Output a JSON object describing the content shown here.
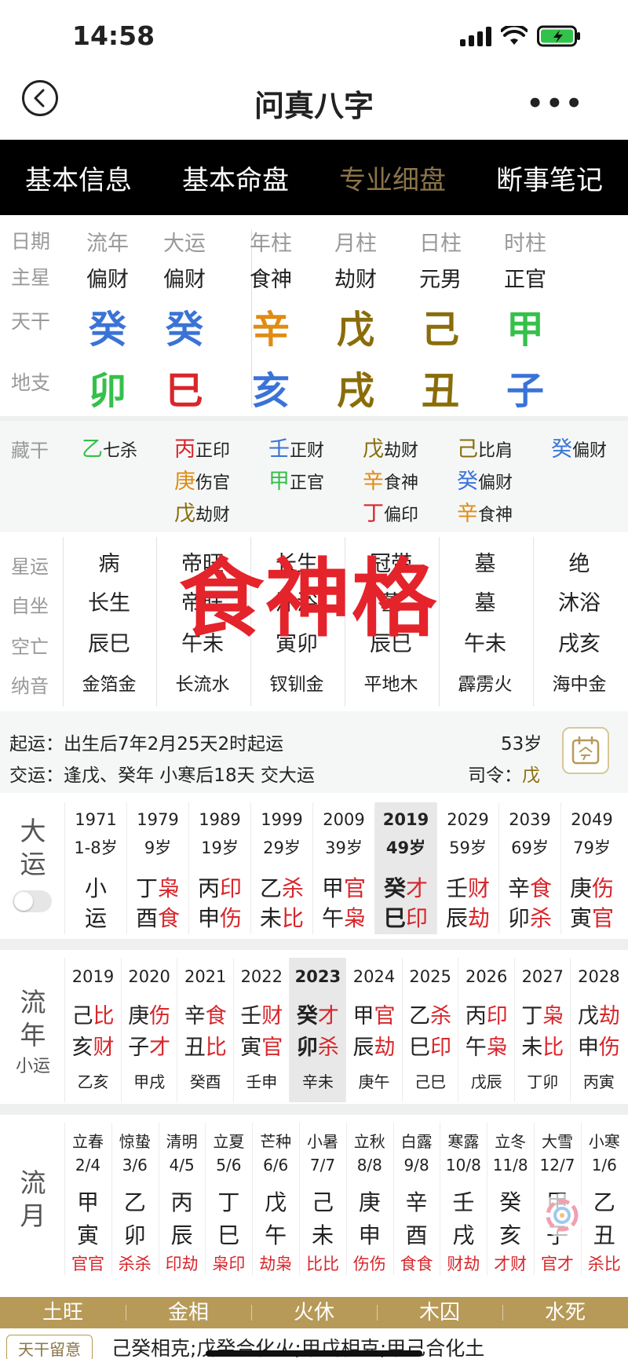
{
  "status": {
    "time": "14:58"
  },
  "nav": {
    "title": "问真八字",
    "more": "•••"
  },
  "tabs": [
    "基本信息",
    "基本命盘",
    "专业细盘",
    "断事笔记"
  ],
  "pillars": {
    "row_labels": {
      "rizhu": "日期",
      "star": "主星",
      "gan": "天干",
      "zhi": "地支"
    },
    "columns": [
      {
        "head": "流年",
        "star": "偏财",
        "gan": "癸",
        "gan_color": "#3a73d6",
        "zhi": "卯",
        "zhi_color": "#35c04a"
      },
      {
        "head": "大运",
        "star": "偏财",
        "gan": "癸",
        "gan_color": "#3a73d6",
        "zhi": "巳",
        "zhi_color": "#d8262b"
      },
      {
        "head": "年柱",
        "star": "食神",
        "gan": "辛",
        "gan_color": "#e08b13",
        "zhi": "亥",
        "zhi_color": "#3a73d6"
      },
      {
        "head": "月柱",
        "star": "劫财",
        "gan": "戊",
        "gan_color": "#8a6d0a",
        "zhi": "戌",
        "zhi_color": "#8a6d0a"
      },
      {
        "head": "日柱",
        "star": "元男",
        "gan": "己",
        "gan_color": "#8a6d0a",
        "zhi": "丑",
        "zhi_color": "#8a6d0a"
      },
      {
        "head": "时柱",
        "star": "正官",
        "gan": "甲",
        "gan_color": "#35c04a",
        "zhi": "子",
        "zhi_color": "#3a73d6"
      }
    ]
  },
  "canggan": {
    "label": "藏干",
    "columns": [
      [
        {
          "g": "乙",
          "c": "#35c04a",
          "s": "七杀"
        }
      ],
      [
        {
          "g": "丙",
          "c": "#d8262b",
          "s": "正印"
        },
        {
          "g": "庚",
          "c": "#e08b13",
          "s": "伤官"
        },
        {
          "g": "戊",
          "c": "#8a6d0a",
          "s": "劫财"
        }
      ],
      [
        {
          "g": "壬",
          "c": "#3a73d6",
          "s": "正财"
        },
        {
          "g": "甲",
          "c": "#35c04a",
          "s": "正官"
        }
      ],
      [
        {
          "g": "戊",
          "c": "#8a6d0a",
          "s": "劫财"
        },
        {
          "g": "辛",
          "c": "#e08b13",
          "s": "食神"
        },
        {
          "g": "丁",
          "c": "#d8262b",
          "s": "偏印"
        }
      ],
      [
        {
          "g": "己",
          "c": "#8a6d0a",
          "s": "比肩"
        },
        {
          "g": "癸",
          "c": "#3a73d6",
          "s": "偏财"
        },
        {
          "g": "辛",
          "c": "#e08b13",
          "s": "食神"
        }
      ],
      [
        {
          "g": "癸",
          "c": "#3a73d6",
          "s": "偏财"
        }
      ]
    ]
  },
  "grid2": {
    "labels": [
      "星运",
      "自坐",
      "空亡",
      "纳音"
    ],
    "columns": [
      [
        "病",
        "长生",
        "辰巳",
        "金箔金"
      ],
      [
        "帝旺",
        "帝旺",
        "午未",
        "长流水"
      ],
      [
        "长生",
        "沐浴",
        "寅卯",
        "钗钏金"
      ],
      [
        "冠带",
        "墓",
        "辰巳",
        "平地木"
      ],
      [
        "墓",
        "墓",
        "午未",
        "霹雳火"
      ],
      [
        "绝",
        "沐浴",
        "戌亥",
        "海中金"
      ]
    ],
    "overlay": "食神格"
  },
  "qiyun": {
    "line1": "起运：出生后7年2月25天2时起运",
    "line2": "交运：逢戊、癸年 小寒后18天 交大运",
    "age": "53岁",
    "siling_label": "司令：",
    "siling_value": "戊"
  },
  "dayun": {
    "label": [
      "大",
      "运"
    ],
    "columns": [
      {
        "year": "1971",
        "age": "1-8岁",
        "g1": "小",
        "g1s": "",
        "g2": "运",
        "g2s": ""
      },
      {
        "year": "1979",
        "age": "9岁",
        "g1": "丁",
        "g1s": "枭",
        "g2": "酉",
        "g2s": "食"
      },
      {
        "year": "1989",
        "age": "19岁",
        "g1": "丙",
        "g1s": "印",
        "g2": "申",
        "g2s": "伤"
      },
      {
        "year": "1999",
        "age": "29岁",
        "g1": "乙",
        "g1s": "杀",
        "g2": "未",
        "g2s": "比"
      },
      {
        "year": "2009",
        "age": "39岁",
        "g1": "甲",
        "g1s": "官",
        "g2": "午",
        "g2s": "枭"
      },
      {
        "year": "2019",
        "age": "49岁",
        "g1": "癸",
        "g1s": "才",
        "g2": "巳",
        "g2s": "印",
        "selected": true
      },
      {
        "year": "2029",
        "age": "59岁",
        "g1": "壬",
        "g1s": "财",
        "g2": "辰",
        "g2s": "劫"
      },
      {
        "year": "2039",
        "age": "69岁",
        "g1": "辛",
        "g1s": "食",
        "g2": "卯",
        "g2s": "杀"
      },
      {
        "year": "2049",
        "age": "79岁",
        "g1": "庚",
        "g1s": "伤",
        "g2": "寅",
        "g2s": "官"
      }
    ]
  },
  "liunian": {
    "label": [
      "流",
      "年"
    ],
    "sub": "小运",
    "columns": [
      {
        "year": "2019",
        "g1": "己",
        "g1s": "比",
        "g2": "亥",
        "g2s": "财",
        "xy": "乙亥"
      },
      {
        "year": "2020",
        "g1": "庚",
        "g1s": "伤",
        "g2": "子",
        "g2s": "才",
        "xy": "甲戌"
      },
      {
        "year": "2021",
        "g1": "辛",
        "g1s": "食",
        "g2": "丑",
        "g2s": "比",
        "xy": "癸酉"
      },
      {
        "year": "2022",
        "g1": "壬",
        "g1s": "财",
        "g2": "寅",
        "g2s": "官",
        "xy": "壬申"
      },
      {
        "year": "2023",
        "g1": "癸",
        "g1s": "才",
        "g2": "卯",
        "g2s": "杀",
        "xy": "辛未",
        "selected": true
      },
      {
        "year": "2024",
        "g1": "甲",
        "g1s": "官",
        "g2": "辰",
        "g2s": "劫",
        "xy": "庚午"
      },
      {
        "year": "2025",
        "g1": "乙",
        "g1s": "杀",
        "g2": "巳",
        "g2s": "印",
        "xy": "己巳"
      },
      {
        "year": "2026",
        "g1": "丙",
        "g1s": "印",
        "g2": "午",
        "g2s": "枭",
        "xy": "戊辰"
      },
      {
        "year": "2027",
        "g1": "丁",
        "g1s": "枭",
        "g2": "未",
        "g2s": "比",
        "xy": "丁卯"
      },
      {
        "year": "2028",
        "g1": "戊",
        "g1s": "劫",
        "g2": "申",
        "g2s": "伤",
        "xy": "丙寅"
      }
    ]
  },
  "liuyue": {
    "label": [
      "流",
      "月"
    ],
    "columns": [
      {
        "jq": "立春",
        "dt": "2/4",
        "g1": "甲",
        "g2": "寅",
        "ss": "官官"
      },
      {
        "jq": "惊蛰",
        "dt": "3/6",
        "g1": "乙",
        "g2": "卯",
        "ss": "杀杀"
      },
      {
        "jq": "清明",
        "dt": "4/5",
        "g1": "丙",
        "g2": "辰",
        "ss": "印劫"
      },
      {
        "jq": "立夏",
        "dt": "5/6",
        "g1": "丁",
        "g2": "巳",
        "ss": "枭印"
      },
      {
        "jq": "芒种",
        "dt": "6/6",
        "g1": "戊",
        "g2": "午",
        "ss": "劫枭"
      },
      {
        "jq": "小暑",
        "dt": "7/7",
        "g1": "己",
        "g2": "未",
        "ss": "比比"
      },
      {
        "jq": "立秋",
        "dt": "8/8",
        "g1": "庚",
        "g2": "申",
        "ss": "伤伤"
      },
      {
        "jq": "白露",
        "dt": "9/8",
        "g1": "辛",
        "g2": "酉",
        "ss": "食食"
      },
      {
        "jq": "寒露",
        "dt": "10/8",
        "g1": "壬",
        "g2": "戌",
        "ss": "财劫"
      },
      {
        "jq": "立冬",
        "dt": "11/8",
        "g1": "癸",
        "g2": "亥",
        "ss": "才财"
      },
      {
        "jq": "大雪",
        "dt": "12/7",
        "g1": "甲",
        "g2": "子",
        "ss": "官才"
      },
      {
        "jq": "小寒",
        "dt": "1/6",
        "g1": "乙",
        "g2": "丑",
        "ss": "杀比"
      }
    ]
  },
  "season": [
    "土旺",
    "金相",
    "火休",
    "木囚",
    "水死"
  ],
  "note": {
    "tag": "天干留意",
    "text": "己癸相克;戊癸合化火;甲戊相克;甲己合化土"
  }
}
